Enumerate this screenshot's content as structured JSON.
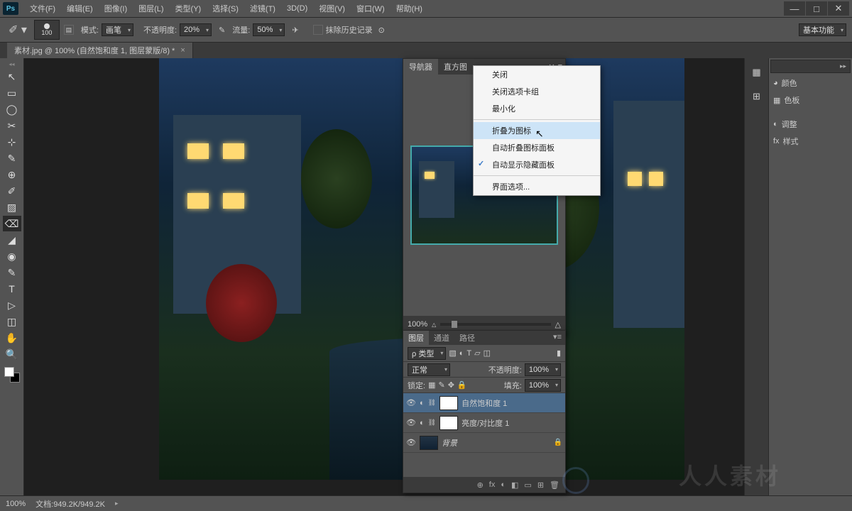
{
  "menu": {
    "items": [
      "文件(F)",
      "编辑(E)",
      "图像(I)",
      "图层(L)",
      "类型(Y)",
      "选择(S)",
      "滤镜(T)",
      "3D(D)",
      "视图(V)",
      "窗口(W)",
      "帮助(H)"
    ],
    "logo": "Ps"
  },
  "window_ctl": {
    "min": "—",
    "max": "□",
    "close": "✕"
  },
  "opt": {
    "brush_size": "100",
    "mode_label": "模式:",
    "mode_value": "画笔",
    "opacity_label": "不透明度:",
    "opacity_value": "20%",
    "flow_label": "流量:",
    "flow_value": "50%",
    "history_label": "抹除历史记录",
    "workspace": "基本功能"
  },
  "doc_tab": {
    "title": "素材.jpg @ 100% (自然饱和度 1, 图层蒙版/8) *",
    "close": "×"
  },
  "navigator": {
    "tabs": [
      "导航器",
      "直方图"
    ],
    "zoom": "100%",
    "collapse": "◂◂",
    "close": "✕",
    "menu": "≡"
  },
  "context_menu": {
    "items": [
      {
        "label": "关闭"
      },
      {
        "label": "关闭选项卡组"
      },
      {
        "label": "最小化"
      },
      {
        "sep": true
      },
      {
        "label": "折叠为图标",
        "hover": true
      },
      {
        "label": "自动折叠图标面板"
      },
      {
        "label": "自动显示隐藏面板",
        "checked": true
      },
      {
        "sep": true
      },
      {
        "label": "界面选项..."
      }
    ]
  },
  "layers": {
    "tabs": [
      "图层",
      "通道",
      "路径"
    ],
    "filter": "ρ 类型",
    "blend": "正常",
    "opacity_label": "不透明度:",
    "opacity": "100%",
    "lock_label": "锁定:",
    "fill_label": "填充:",
    "fill": "100%",
    "rows": [
      {
        "name": "自然饱和度 1",
        "adj": true,
        "sel": true
      },
      {
        "name": "亮度/对比度 1",
        "adj": true
      },
      {
        "name": "背景",
        "bg": true,
        "locked": true
      }
    ],
    "foot_icons": [
      "⊕",
      "fx",
      "◐",
      "◧",
      "▭",
      "⊞",
      "🗑"
    ]
  },
  "right": {
    "well_icons": [
      "▦",
      "⊞"
    ],
    "panels": [
      {
        "icon": "◕",
        "label": "颜色"
      },
      {
        "icon": "▦",
        "label": "色板"
      },
      {
        "gap": true
      },
      {
        "icon": "◐",
        "label": "调整"
      },
      {
        "icon": "fx",
        "label": "样式"
      }
    ]
  },
  "status": {
    "zoom": "100%",
    "info": "文档:949.2K/949.2K"
  },
  "tools": [
    "↖",
    "▭",
    "◯",
    "✂",
    "⊹",
    "✎",
    "⊕",
    "✐",
    "▨",
    "⌫",
    "◢",
    "◉",
    "✎",
    "T",
    "▷",
    "◫",
    "✋",
    "🔍"
  ]
}
